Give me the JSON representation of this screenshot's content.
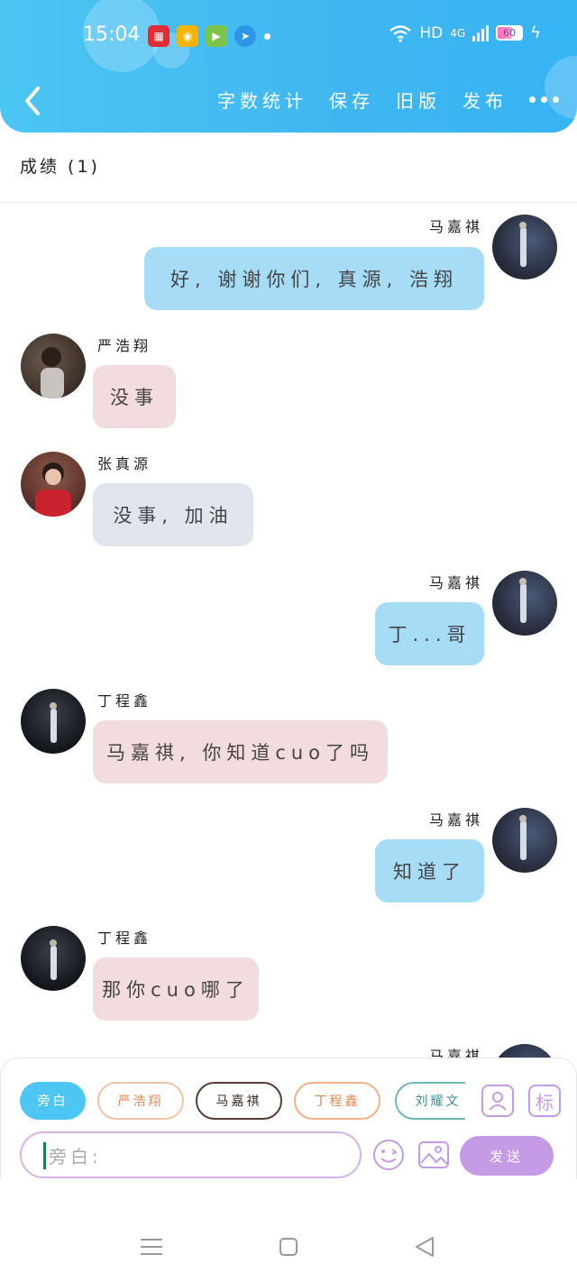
{
  "status_bar": {
    "time": "15:04",
    "network": "HD",
    "signal_label": "4G",
    "battery": "60"
  },
  "toolbar": {
    "word_count": "字数统计",
    "save": "保存",
    "old_version": "旧版",
    "publish": "发布"
  },
  "chat_title": "成绩 (1)",
  "messages": [
    {
      "name": "马嘉祺",
      "text": "好, 谢谢你们, 真源, 浩翔",
      "side": "right"
    },
    {
      "name": "严浩翔",
      "text": "没事",
      "side": "left"
    },
    {
      "name": "张真源",
      "text": "没事, 加油",
      "side": "left"
    },
    {
      "name": "马嘉祺",
      "text": "丁...哥",
      "side": "right"
    },
    {
      "name": "丁程鑫",
      "text": "马嘉祺, 你知道cuo了吗",
      "side": "left"
    },
    {
      "name": "马嘉祺",
      "text": "知道了",
      "side": "right"
    },
    {
      "name": "丁程鑫",
      "text": "那你cuo哪了",
      "side": "left"
    },
    {
      "name": "马嘉祺",
      "text": "",
      "side": "right"
    }
  ],
  "composer": {
    "chips": [
      "旁白",
      "严浩翔",
      "马嘉祺",
      "丁程鑫",
      "刘耀文"
    ],
    "placeholder": "旁白:",
    "tag_button": "标",
    "send": "发送"
  },
  "colors": {
    "header": "#40b6f0",
    "bubble_self": "#a6dcf6",
    "bubble_pink": "#f3dcdd",
    "bubble_gray": "#e1e6ee",
    "accent_purple": "#c49be4"
  }
}
